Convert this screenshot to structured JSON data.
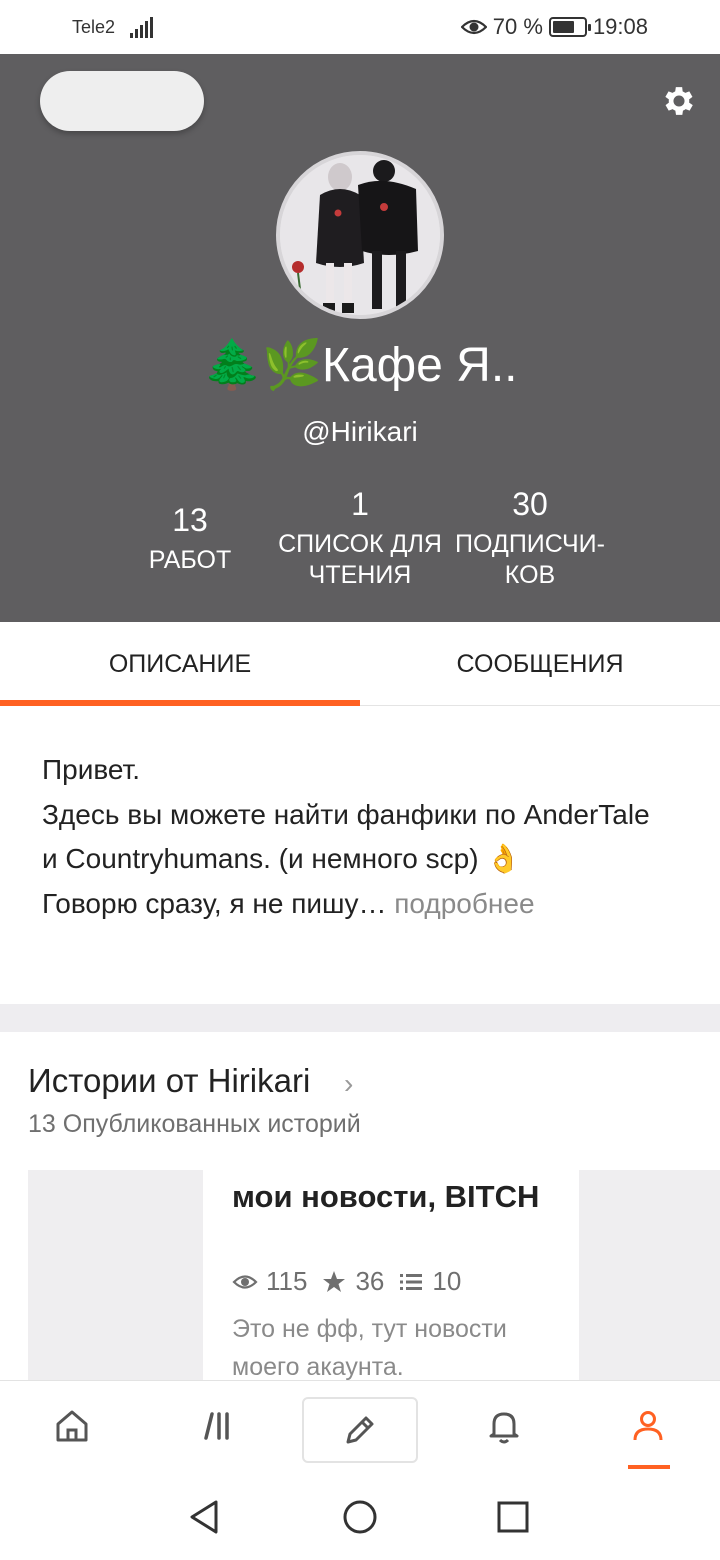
{
  "status_bar": {
    "carrier": "Tele2",
    "battery": "70 %",
    "battery_level": 0.7,
    "time": "19:08",
    "icons": [
      "signal-icon",
      "eye-icon",
      "battery-icon"
    ]
  },
  "profile": {
    "display_name": "🌲🌿Кафе Я..",
    "username": "@Hirikari",
    "stats": [
      {
        "value": "13",
        "label": "РАБОТ"
      },
      {
        "value": "1",
        "label": "СПИСОК ДЛЯ ЧТЕНИЯ"
      },
      {
        "value": "30",
        "label": "ПОДПИСЧИ- КОВ"
      }
    ],
    "settings_icon": "gear-icon"
  },
  "tabs": [
    {
      "label": "ОПИСАНИЕ",
      "active": true
    },
    {
      "label": "СООБЩЕНИЯ",
      "active": false
    }
  ],
  "description": {
    "line1": "Привет.",
    "line2": "Здесь вы можете найти фанфики по AnderTale и Countryhumans. (и немного scp) 👌",
    "line3": "Говорю сразу, я не пишу…",
    "more": "подробнее"
  },
  "stories": {
    "title": "Истории от Hirikari",
    "subtitle": "13 Опубликованных историй",
    "items": [
      {
        "title": "мои новости, BITCH",
        "views": "115",
        "votes": "36",
        "parts": "10",
        "description": "Это не фф, тут новости моего акаунта."
      }
    ]
  },
  "bottom_nav": {
    "items": [
      "home-icon",
      "library-icon",
      "write-icon",
      "notifications-icon",
      "profile-icon"
    ],
    "active": "profile-icon"
  },
  "colors": {
    "header_bg": "#5f5e60",
    "accent": "#ff6122"
  }
}
